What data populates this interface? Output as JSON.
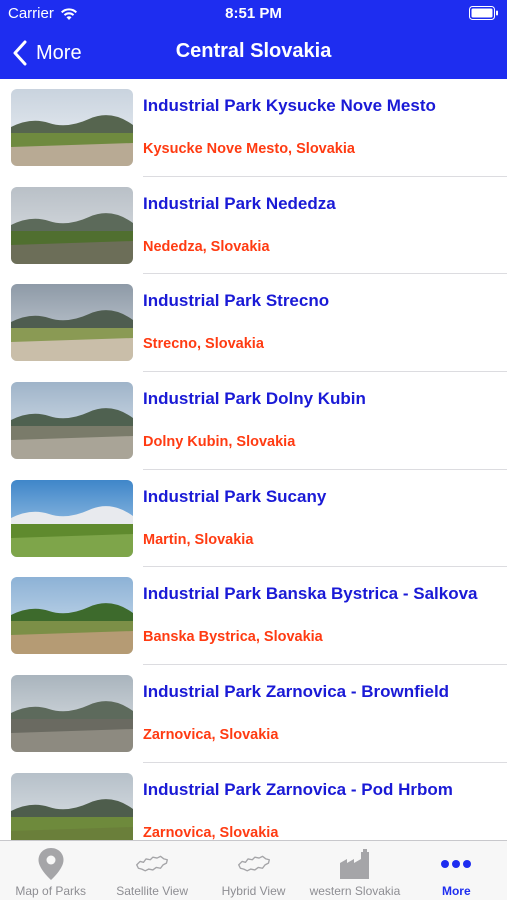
{
  "status_bar": {
    "carrier": "Carrier",
    "time": "8:51 PM"
  },
  "nav": {
    "back_label": "More",
    "title": "Central Slovakia"
  },
  "colors": {
    "accent": "#1e2df0",
    "title": "#1a1ad6",
    "subtitle": "#ff3b12"
  },
  "parks": [
    {
      "title": "Industrial Park Kysucke Nove Mesto",
      "location": "Kysucke Nove Mesto, Slovakia"
    },
    {
      "title": "Industrial Park Nededza",
      "location": "Nededza, Slovakia"
    },
    {
      "title": "Industrial Park Strecno",
      "location": "Strecno, Slovakia"
    },
    {
      "title": "Industrial Park Dolny Kubin",
      "location": "Dolny Kubin, Slovakia"
    },
    {
      "title": "Industrial Park Sucany",
      "location": "Martin, Slovakia"
    },
    {
      "title": "Industrial Park Banska Bystrica - Salkova",
      "location": "Banska Bystrica, Slovakia"
    },
    {
      "title": "Industrial Park Zarnovica - Brownfield",
      "location": "Zarnovica, Slovakia"
    },
    {
      "title": "Industrial Park Zarnovica - Pod Hrbom",
      "location": "Zarnovica, Slovakia"
    }
  ],
  "tabs": [
    {
      "label": "Map of Parks",
      "icon": "map-pin-icon"
    },
    {
      "label": "Satellite View",
      "icon": "slovakia-outline-icon"
    },
    {
      "label": "Hybrid View",
      "icon": "slovakia-outline-icon"
    },
    {
      "label": "western Slovakia",
      "icon": "factory-icon"
    },
    {
      "label": "More",
      "icon": "more-dots-icon",
      "selected": true
    }
  ]
}
